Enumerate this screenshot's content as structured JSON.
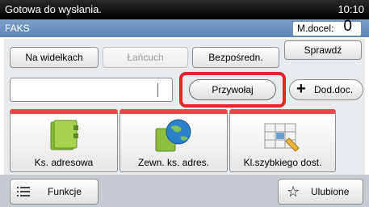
{
  "status": {
    "message": "Gotowa do wysłania.",
    "time": "10:10"
  },
  "title": {
    "mode": "FAKS",
    "dest_label": "M.docel:",
    "dest_count": "0"
  },
  "line_buttons": {
    "on_hook": "Na widełkach",
    "chain": "Łańcuch",
    "direct": "Bezpośredn.",
    "check": "Sprawdź"
  },
  "entry": {
    "value": ""
  },
  "recall_label": "Przywołaj",
  "add_dest_label": "Dod.doc.",
  "tiles": [
    {
      "label": "Ks. adresowa",
      "icon": "address-book-icon"
    },
    {
      "label": "Zewn. ks. adres.",
      "icon": "globe-book-icon"
    },
    {
      "label": "Kl.szybkiego dost.",
      "icon": "speed-dial-icon"
    }
  ],
  "bottom": {
    "functions": "Funkcje",
    "favorites": "Ulubione"
  },
  "colors": {
    "highlight": "#e8232a",
    "tile_accent": "#e24b4b",
    "title_bar": "#6b93c0"
  }
}
